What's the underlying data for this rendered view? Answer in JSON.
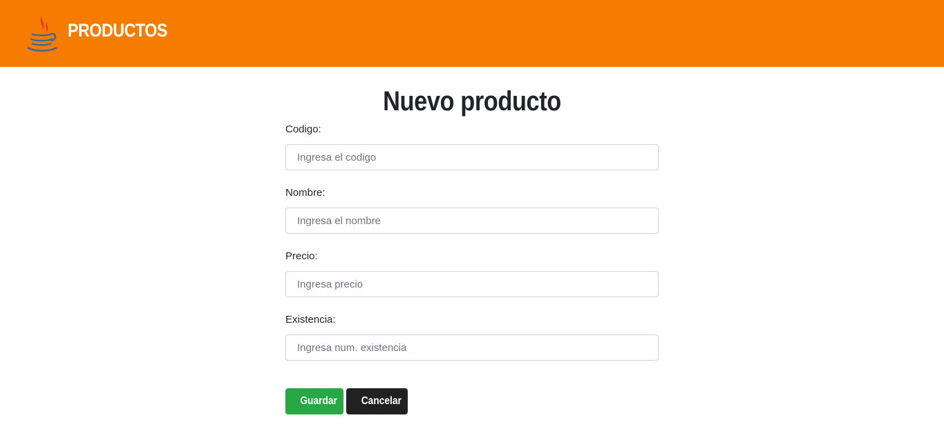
{
  "navbar": {
    "logo_icon": "java-coffee-cup-icon",
    "brand_text": "PRODUCTOS",
    "background": "#f57c00"
  },
  "page": {
    "title": "Nuevo producto"
  },
  "form": {
    "fields": [
      {
        "label": "Codigo:",
        "placeholder": "Ingresa el codigo",
        "value": ""
      },
      {
        "label": "Nombre:",
        "placeholder": "Ingresa el nombre",
        "value": ""
      },
      {
        "label": "Precio:",
        "placeholder": "Ingresa precio",
        "value": ""
      },
      {
        "label": "Existencia:",
        "placeholder": "Ingresa num. existencia",
        "value": ""
      }
    ],
    "save_label": "Guardar",
    "cancel_label": "Cancelar",
    "save_color": "#28a745",
    "cancel_color": "#212121"
  }
}
